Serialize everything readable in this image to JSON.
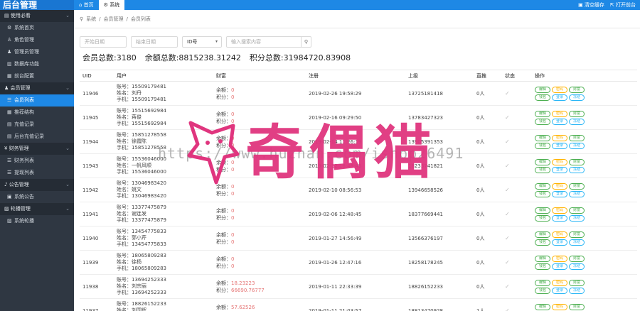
{
  "app": {
    "title": "后台管理"
  },
  "tabs": [
    {
      "label": "首页",
      "icon": "home-icon"
    },
    {
      "label": "系统",
      "icon": "gear-icon"
    }
  ],
  "topright": {
    "clear_cache": "清空缓存",
    "open_frontend": "打开前台"
  },
  "sidebar": {
    "groups": [
      {
        "label": "使用必看",
        "items": [
          {
            "label": "系统首页"
          },
          {
            "label": "角色管理"
          },
          {
            "label": "管理员管理"
          },
          {
            "label": "数据库功能"
          },
          {
            "label": "前台配置"
          }
        ]
      },
      {
        "label": "会员管理",
        "items": [
          {
            "label": "会员列表",
            "active": true
          },
          {
            "label": "推荐结构"
          },
          {
            "label": "充值记录"
          },
          {
            "label": "后台充值记录"
          }
        ]
      },
      {
        "label": "财务管理",
        "items": [
          {
            "label": "财务列表"
          },
          {
            "label": "提现列表"
          }
        ]
      },
      {
        "label": "公告管理",
        "items": [
          {
            "label": "系统公告"
          }
        ]
      },
      {
        "label": "轮播管理",
        "items": [
          {
            "label": "系统轮播"
          }
        ]
      }
    ]
  },
  "breadcrumb": [
    "系统",
    "会员管理",
    "会员列表"
  ],
  "filters": {
    "start_date": "开始日期",
    "end_date": "结束日期",
    "id_select": "ID号",
    "search_placeholder": "输入搜索内容"
  },
  "stats": {
    "members": "会员总数:3180",
    "balance": "余额总数:8815238.31242",
    "points": "积分总数:31984720.83908"
  },
  "table": {
    "headers": [
      "UID",
      "用户",
      "财富",
      "注册",
      "上级",
      "直推",
      "状态",
      "操作"
    ],
    "op_labels": [
      "编辑",
      "密码",
      "财富",
      "钱包",
      "登录",
      "冻结"
    ],
    "rows": [
      {
        "uid": "11946",
        "u1": "账号：15509179481",
        "u2": "姓名：刘丹",
        "u3": "手机：15509179481",
        "bal": "余额：",
        "balv": "0",
        "pts": "积分：",
        "ptsv": "0",
        "reg": "2019-02-26 19:58:29",
        "sup": "13725181418",
        "direct": "0人"
      },
      {
        "uid": "11945",
        "u1": "账号：15515692984",
        "u2": "姓名：蒋俊",
        "u3": "手机：15515692984",
        "bal": "余额：",
        "balv": "0",
        "pts": "积分：",
        "ptsv": "0",
        "reg": "2019-02-16 09:29:50",
        "sup": "13783427323",
        "direct": "0人"
      },
      {
        "uid": "11944",
        "u1": "账号：15851278558",
        "u2": "姓名：徐霞陈",
        "u3": "手机：15851278558",
        "bal": "余额：",
        "balv": "0",
        "pts": "积分：",
        "ptsv": "0",
        "reg": "2019-02-14 11:26:19",
        "sup": "13905391353",
        "direct": "0人"
      },
      {
        "uid": "11943",
        "u1": "账号：15536046000",
        "u2": "姓名：一帆风顺",
        "u3": "手机：15536046000",
        "bal": "余额：",
        "balv": "0",
        "pts": "积分：",
        "ptsv": "0",
        "reg": "2019-02-12 16:48:45",
        "sup": "18235741821",
        "direct": "0人"
      },
      {
        "uid": "11942",
        "u1": "账号：13046983420",
        "u2": "姓名：姚文",
        "u3": "手机：13046983420",
        "bal": "余额：",
        "balv": "0",
        "pts": "积分：",
        "ptsv": "0",
        "reg": "2019-02-10 08:56:53",
        "sup": "13946658526",
        "direct": "0人"
      },
      {
        "uid": "11941",
        "u1": "账号：13377475879",
        "u2": "姓名：谢连发",
        "u3": "手机：13377475879",
        "bal": "余额：",
        "balv": "0",
        "pts": "积分：",
        "ptsv": "0",
        "reg": "2019-02-06 12:48:45",
        "sup": "18377669441",
        "direct": "0人"
      },
      {
        "uid": "11940",
        "u1": "账号：13454775833",
        "u2": "姓名：郭小芹",
        "u3": "手机：13454775833",
        "bal": "余额：",
        "balv": "0",
        "pts": "积分：",
        "ptsv": "0",
        "reg": "2019-01-27 14:56:49",
        "sup": "13566376197",
        "direct": "0人"
      },
      {
        "uid": "11939",
        "u1": "账号：18065809283",
        "u2": "姓名：徐杨",
        "u3": "手机：18065809283",
        "bal": "余额：",
        "balv": "0",
        "pts": "积分：",
        "ptsv": "0",
        "reg": "2019-01-26 12:47:16",
        "sup": "18258178245",
        "direct": "0人"
      },
      {
        "uid": "11938",
        "u1": "账号：13694252333",
        "u2": "姓名：刘宗丽",
        "u3": "手机：13694252333",
        "bal": "余额：",
        "balv": "18.23223",
        "pts": "积分：",
        "ptsv": "66690.76777",
        "reg": "2019-01-11 22:33:39",
        "sup": "18826152233",
        "direct": "0人"
      },
      {
        "uid": "11937",
        "u1": "账号：18826152233",
        "u2": "姓名：刘国辉",
        "u3": "手机：18826152233",
        "bal": "余额：",
        "balv": "57.62526",
        "pts": "积分：",
        "ptsv": "",
        "reg": "2019-01-11 21:03:57",
        "sup": "18813470928",
        "direct": "1人"
      }
    ]
  },
  "watermark": {
    "url": "https://www.huzhan.com/ishop26491",
    "logo_text": "奇偶猫"
  },
  "colors": {
    "topbar": "#1e88e5",
    "sidebar": "#2f3742",
    "active": "#1e88e5",
    "watermark": "#e0357e"
  }
}
